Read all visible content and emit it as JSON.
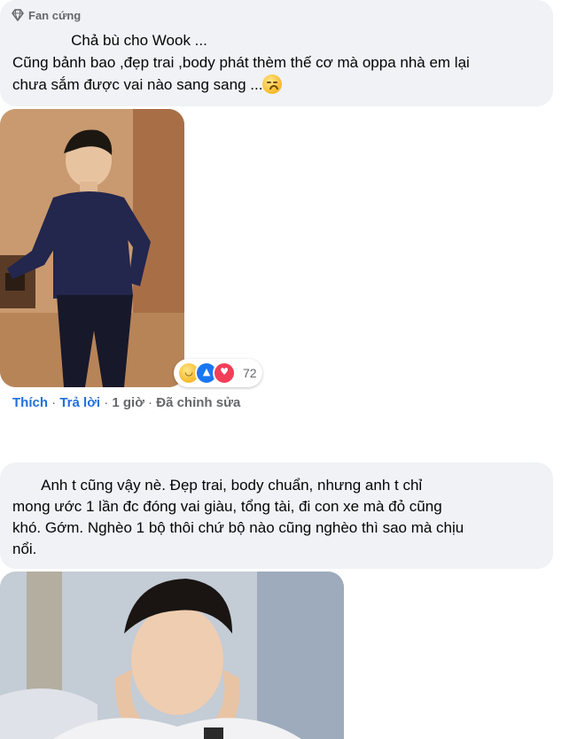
{
  "comment1": {
    "badge_icon": "diamond-icon",
    "badge_label": "Fan cứng",
    "lines": [
      "              Chả bù cho Wook ...",
      "Cũng bảnh bao ,đẹp trai ,body phát thèm thế cơ mà oppa nhà em lại",
      "chưa sắm được vai nào sang sang ..."
    ],
    "emoji": "sad-face-emoji",
    "reactions": {
      "icons": [
        "haha-icon",
        "like-icon",
        "love-icon"
      ],
      "count": "72"
    },
    "actions": {
      "like": "Thích",
      "reply": "Trả lời",
      "time": "1 giờ",
      "edited": "Đã chỉnh sửa"
    }
  },
  "comment2": {
    "lines": [
      "       Anh t cũng vậy nè. Đẹp trai, body chuẩn, nhưng anh t chỉ",
      "mong ước 1 lần đc đóng vai giàu, tổng tài, đi con xe mà đỏ cũng",
      "khó. Gớm. Nghèo 1 bộ thôi chứ bộ nào cũng nghèo thì sao mà chịu",
      "nổi."
    ]
  },
  "colors": {
    "bubble": "#f0f2f5",
    "link": "#385898",
    "meta": "#65676b",
    "like": "#1877f2",
    "love": "#f33e58",
    "haha": "#f7b928"
  }
}
